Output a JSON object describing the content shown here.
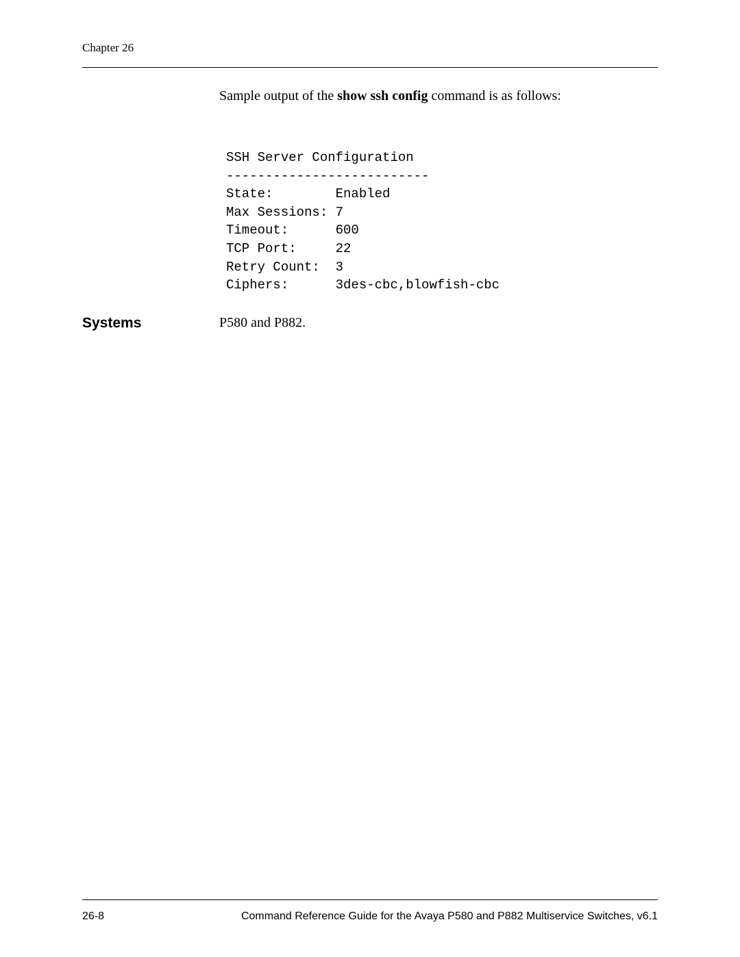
{
  "header": {
    "chapter": "Chapter 26"
  },
  "intro": {
    "prefix": "Sample output of the ",
    "command": "show ssh config",
    "suffix": " command is as follows:"
  },
  "config": {
    "title": "SSH Server Configuration",
    "separator": "--------------------------",
    "rows": [
      {
        "label": "State:",
        "value": "Enabled"
      },
      {
        "label": "Max Sessions:",
        "value": "7"
      },
      {
        "label": "Timeout:",
        "value": "600"
      },
      {
        "label": "TCP Port:",
        "value": "22"
      },
      {
        "label": "Retry Count:",
        "value": "3"
      },
      {
        "label": "Ciphers:",
        "value": "3des-cbc,blowfish-cbc"
      }
    ]
  },
  "systems": {
    "label": "Systems",
    "value": "P580 and P882."
  },
  "footer": {
    "page": "26-8",
    "title": "Command Reference Guide for the Avaya P580 and P882 Multiservice Switches, v6.1"
  }
}
